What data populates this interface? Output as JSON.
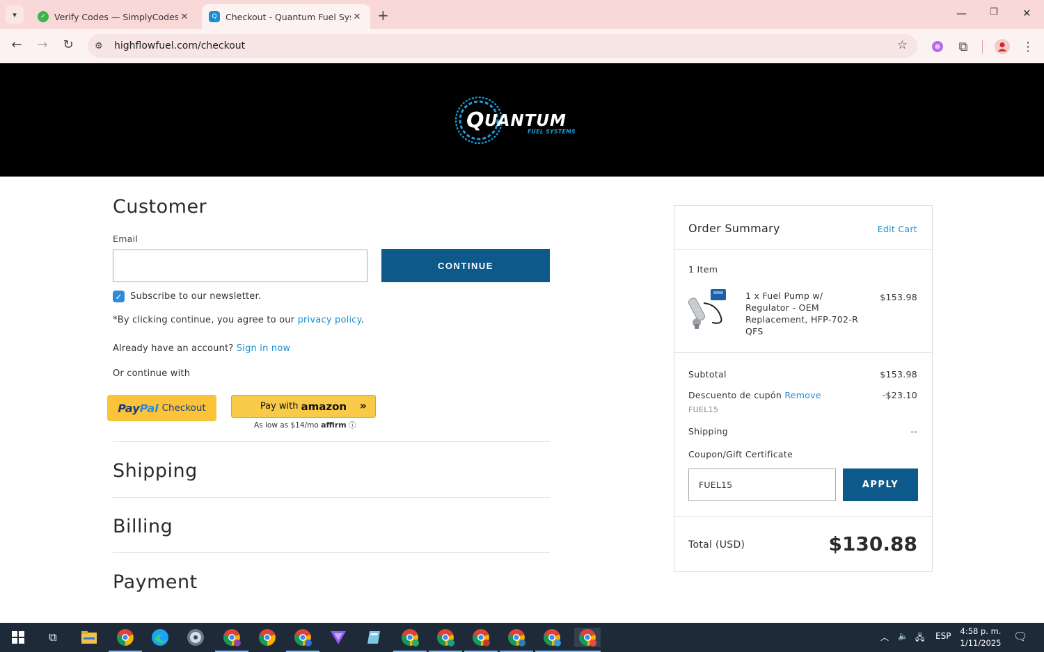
{
  "browser": {
    "tabs": [
      {
        "title": "Verify Codes — SimplyCodes",
        "active": false
      },
      {
        "title": "Checkout - Quantum Fuel Systems",
        "active": true
      }
    ],
    "url": "highflowfuel.com/checkout"
  },
  "header": {
    "logo_main": "QUANTUM",
    "logo_sub": "FUEL SYSTEMS"
  },
  "customer": {
    "heading": "Customer",
    "email_label": "Email",
    "email_value": "",
    "continue_label": "CONTINUE",
    "newsletter_label": "Subscribe to our newsletter.",
    "newsletter_checked": true,
    "terms_prefix": "*By clicking continue, you agree to our",
    "terms_link": "privacy policy",
    "terms_suffix": ".",
    "account_prefix": "Already have an account?",
    "signin_link": "Sign in now",
    "alt_label": "Or continue with",
    "paypal_label": "Checkout",
    "paypal_brand_a": "Pay",
    "paypal_brand_b": "Pal",
    "amazon_prefix": "Pay with",
    "amazon_brand": "amazon",
    "affirm_text": "As low as $14/mo",
    "affirm_brand": "affirm"
  },
  "sections": [
    {
      "heading": "Shipping"
    },
    {
      "heading": "Billing"
    },
    {
      "heading": "Payment"
    }
  ],
  "summary": {
    "title": "Order Summary",
    "edit_cart": "Edit Cart",
    "item_count": "1 Item",
    "item": {
      "name": "1 x Fuel Pump w/ Regulator - OEM Replacement, HFP-702-R QFS",
      "price": "$153.98"
    },
    "subtotal_label": "Subtotal",
    "subtotal": "$153.98",
    "discount_label": "Descuento de cupón",
    "discount_remove": "Remove",
    "discount_code": "FUEL15",
    "discount": "-$23.10",
    "shipping_label": "Shipping",
    "shipping": "--",
    "coupon_label": "Coupon/Gift Certificate",
    "coupon_value": "FUEL15",
    "apply_label": "APPLY",
    "total_label": "Total (USD)",
    "total": "$130.88"
  },
  "taskbar": {
    "language": "ESP",
    "time": "4:58 p. m.",
    "date": "1/11/2025"
  },
  "colors": {
    "brand_button": "#0d5a8a",
    "link": "#1a8fd0",
    "tab_bar": "#f9d8d8",
    "header": "#000000"
  }
}
